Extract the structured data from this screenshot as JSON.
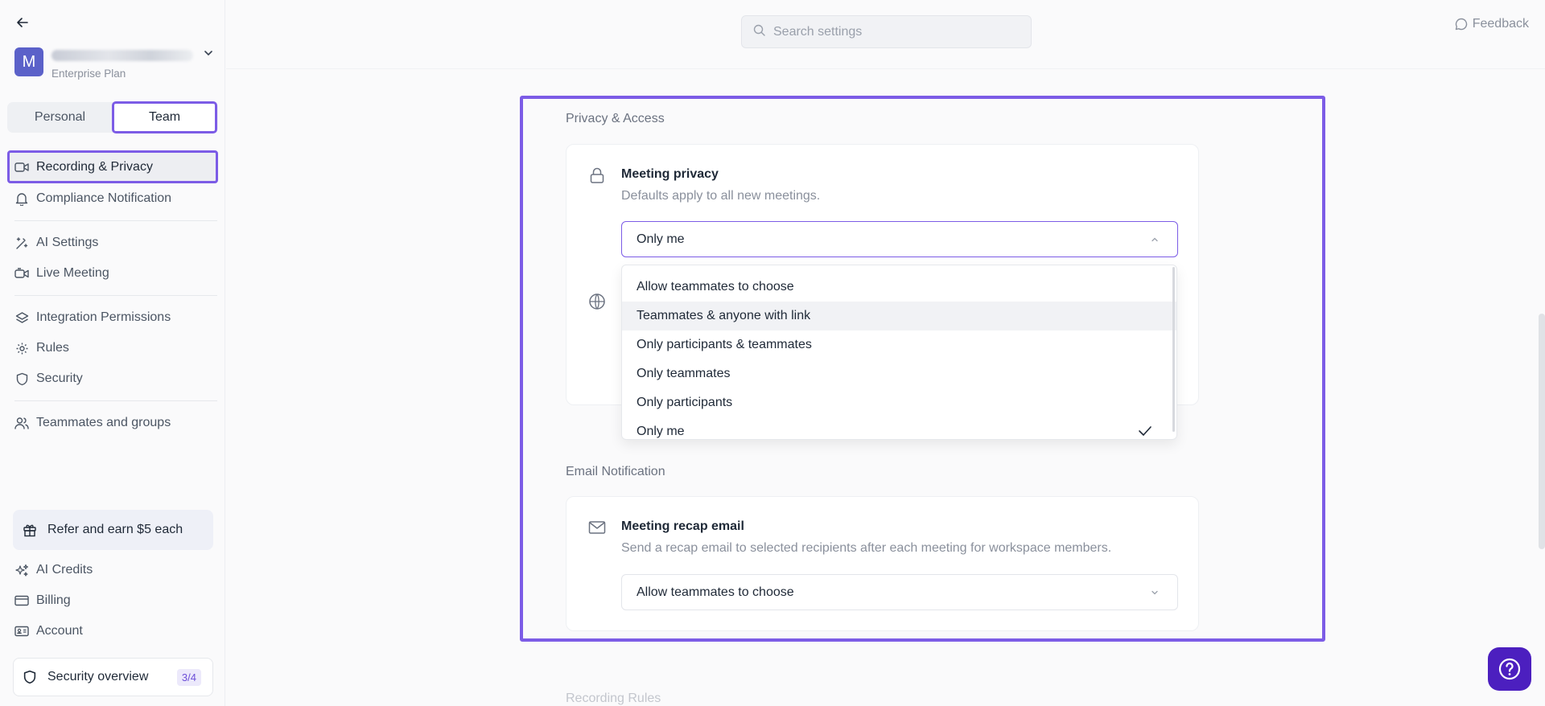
{
  "sidebar": {
    "back_icon": "arrow-left-icon",
    "workspace": {
      "avatar_letter": "M",
      "plan": "Enterprise Plan"
    },
    "segment": {
      "personal": "Personal",
      "team": "Team",
      "active": "Team"
    },
    "nav_groups": [
      [
        {
          "label": "Recording & Privacy",
          "icon": "video-icon",
          "active": true
        },
        {
          "label": "Compliance Notification",
          "icon": "bell-icon"
        }
      ],
      [
        {
          "label": "AI Settings",
          "icon": "magic-wand-icon"
        },
        {
          "label": "Live Meeting",
          "icon": "video-plus-icon"
        }
      ],
      [
        {
          "label": "Integration Permissions",
          "icon": "layers-icon"
        },
        {
          "label": "Rules",
          "icon": "gear-icon"
        },
        {
          "label": "Security",
          "icon": "shield-icon"
        }
      ],
      [
        {
          "label": "Teammates and groups",
          "icon": "users-icon"
        }
      ]
    ],
    "refer": "Refer and earn $5 each",
    "bottom_nav": [
      {
        "label": "AI Credits",
        "icon": "sparkles-icon"
      },
      {
        "label": "Billing",
        "icon": "credit-card-icon"
      },
      {
        "label": "Account",
        "icon": "id-card-icon"
      }
    ],
    "security_overview": {
      "label": "Security overview",
      "badge": "3/4"
    }
  },
  "topbar": {
    "search_placeholder": "Search settings",
    "feedback": "Feedback"
  },
  "main": {
    "privacy_section": "Privacy & Access",
    "meeting_privacy": {
      "title": "Meeting privacy",
      "description": "Defaults apply to all new meetings.",
      "selected": "Only me",
      "options": [
        "Allow teammates to choose",
        "Teammates & anyone with link",
        "Only participants & teammates",
        "Only teammates",
        "Only participants",
        "Only me"
      ],
      "hovered_index": 1,
      "checked_index": 5
    },
    "email_section": "Email Notification",
    "recap_email": {
      "title": "Meeting recap email",
      "description": "Send a recap email to selected recipients after each meeting for workspace members.",
      "selected": "Allow teammates to choose"
    },
    "next_section": "Recording Rules"
  },
  "colors": {
    "accent": "#7c5ce6",
    "avatar": "#5b61c9",
    "help_button": "#4c1fbf"
  }
}
